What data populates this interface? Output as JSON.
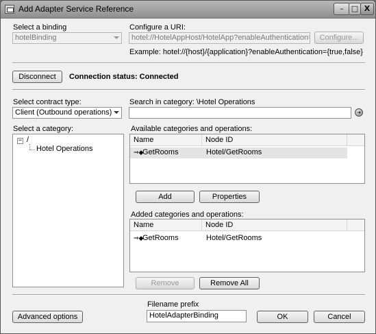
{
  "window": {
    "title": "Add Adapter Service Reference",
    "minimize_glyph": "–",
    "maximize_glyph": "□",
    "close_glyph": "X"
  },
  "binding": {
    "label": "Select a binding",
    "value": "hotelBinding"
  },
  "uri": {
    "label": "Configure a URI:",
    "value": "hotel://HotelAppHost/HotelApp?enableAuthentication=True",
    "configure_button": "Configure...",
    "example": "Example: hotel://{host}/{application}?enableAuthentication={true,false}"
  },
  "connection": {
    "disconnect_button": "Disconnect",
    "status_text": "Connection status: Connected"
  },
  "contract": {
    "label": "Select contract type:",
    "value": "Client (Outbound operations)"
  },
  "search": {
    "label": "Search in category: \\Hotel Operations",
    "value": "",
    "go_icon": "go-arrow-icon"
  },
  "category": {
    "label": "Select a category:",
    "tree": [
      {
        "label": "/",
        "expander": "−"
      },
      {
        "label": "Hotel Operations"
      }
    ]
  },
  "available": {
    "label": "Available categories and operations:",
    "columns": [
      "Name",
      "Node ID"
    ],
    "rows": [
      {
        "icon": "operation-icon",
        "name": "GetRooms",
        "node_id": "Hotel/GetRooms"
      }
    ],
    "add_button": "Add",
    "properties_button": "Properties"
  },
  "added": {
    "label": "Added categories and operations:",
    "columns": [
      "Name",
      "Node ID"
    ],
    "rows": [
      {
        "icon": "operation-icon",
        "name": "GetRooms",
        "node_id": "Hotel/GetRooms"
      }
    ],
    "remove_button": "Remove",
    "remove_all_button": "Remove All"
  },
  "footer": {
    "advanced_button": "Advanced options",
    "filename_label": "Filename prefix",
    "filename_value": "HotelAdapterBinding",
    "ok_button": "OK",
    "cancel_button": "Cancel"
  }
}
